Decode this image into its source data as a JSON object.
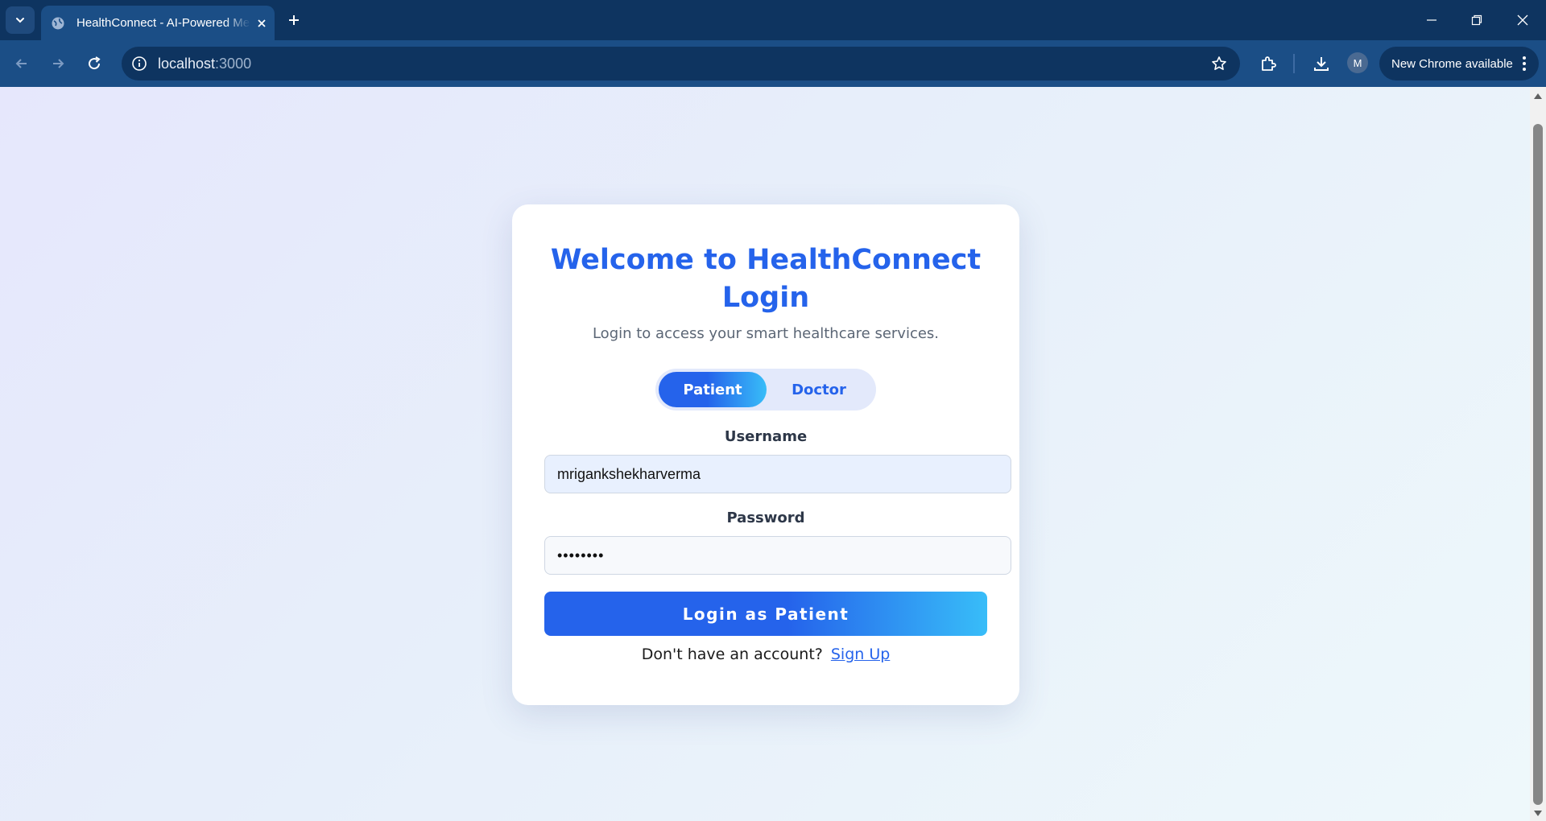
{
  "browser": {
    "tab_title": "HealthConnect - AI-Powered Medical",
    "url_host": "localhost",
    "url_port": ":3000",
    "profile_initial": "M",
    "update_label": "New Chrome available"
  },
  "login": {
    "title": "Welcome to HealthConnect Login",
    "subtitle": "Login to access your smart healthcare services.",
    "roles": [
      "Patient",
      "Doctor"
    ],
    "selected_role": "Patient",
    "username_label": "Username",
    "username_value": "mrigankshekharverma",
    "password_label": "Password",
    "password_value": "password",
    "submit_label": "Login as Patient",
    "signup_prompt": "Don't have an account?",
    "signup_link": "Sign Up"
  },
  "colors": {
    "primary": "#2563eb",
    "accent": "#38bdf8",
    "browser_frame": "#0e3460"
  },
  "icons": [
    "chevron-down-icon",
    "globe-icon",
    "close-icon",
    "plus-icon",
    "minimize-icon",
    "restore-icon",
    "back-arrow-icon",
    "forward-arrow-icon",
    "reload-icon",
    "info-icon",
    "star-icon",
    "extensions-icon",
    "download-icon",
    "kebab-menu-icon"
  ]
}
